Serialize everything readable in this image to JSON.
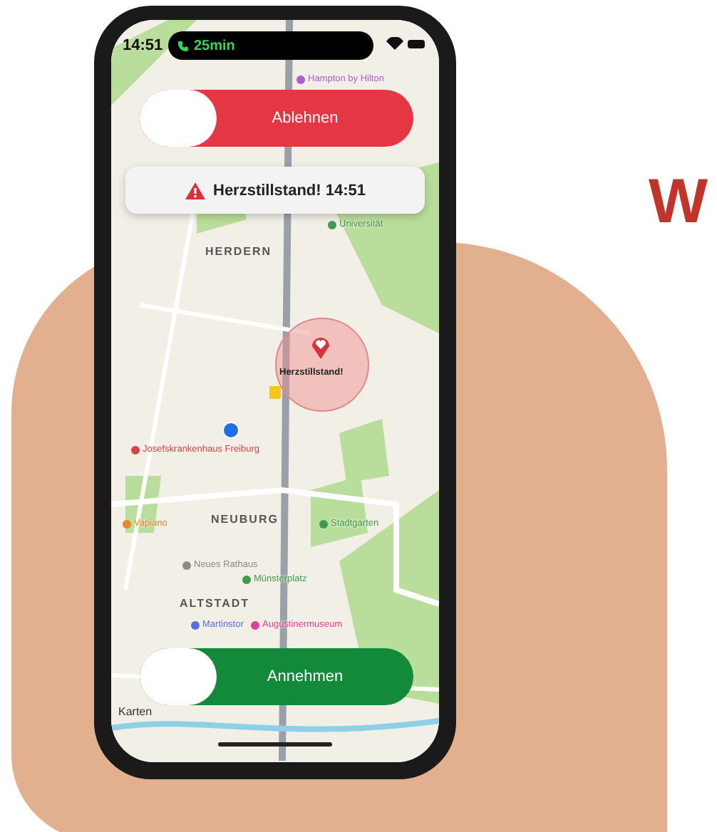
{
  "status_bar": {
    "time": "14:51",
    "call_duration": "25min"
  },
  "decline_slider": {
    "label": "Ablehnen",
    "level": 0
  },
  "alert": {
    "text": "Herzstillstand! 14:51"
  },
  "map": {
    "districts": [
      "HERDERN",
      "NEUBURG",
      "ALTSTADT"
    ],
    "places": [
      {
        "label": "Hampton by Hilton",
        "color": "#b05cd6"
      },
      {
        "label": "Universität",
        "color": "#3e9a4c"
      },
      {
        "label": "Josefskrankenhaus Freiburg",
        "color": "#e0404a"
      },
      {
        "label": "Vapiano",
        "color": "#e8862a"
      },
      {
        "label": "Stadtgarten",
        "color": "#3e9a4c"
      },
      {
        "label": "Neues Rathaus",
        "color": "#8a8a8a"
      },
      {
        "label": "Münsterplatz",
        "color": "#3e9a4c"
      },
      {
        "label": "Martinstor",
        "color": "#5a6ee0"
      },
      {
        "label": "Augustinermuseum",
        "color": "#e0409a"
      }
    ],
    "incident_label": "Herzstillstand!",
    "attribution": "Karten"
  },
  "accept_slider": {
    "label": "Annehmen",
    "level": 0
  },
  "headline_fragment": "W"
}
